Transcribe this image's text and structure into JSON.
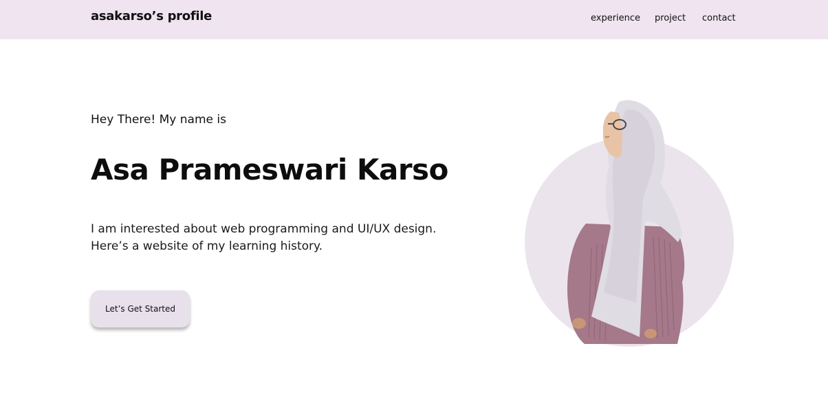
{
  "nav": {
    "brand": "asakarso’s profile",
    "links": [
      "experience",
      "project",
      "contact"
    ]
  },
  "hero": {
    "greeting": "Hey There! My name is",
    "name": "Asa Prameswari Karso",
    "bio_lines": [
      "I am interested about web programming and UI/UX design.",
      "Here’s a website of my learning history."
    ],
    "cta_label": "Let’s Get Started"
  },
  "colors": {
    "nav_bg": "#efe4f0",
    "circle_bg": "#ebe4ec",
    "button_bg": "#e8e0ea"
  },
  "icons": {
    "portrait": "profile-photo-woman-hijab"
  }
}
